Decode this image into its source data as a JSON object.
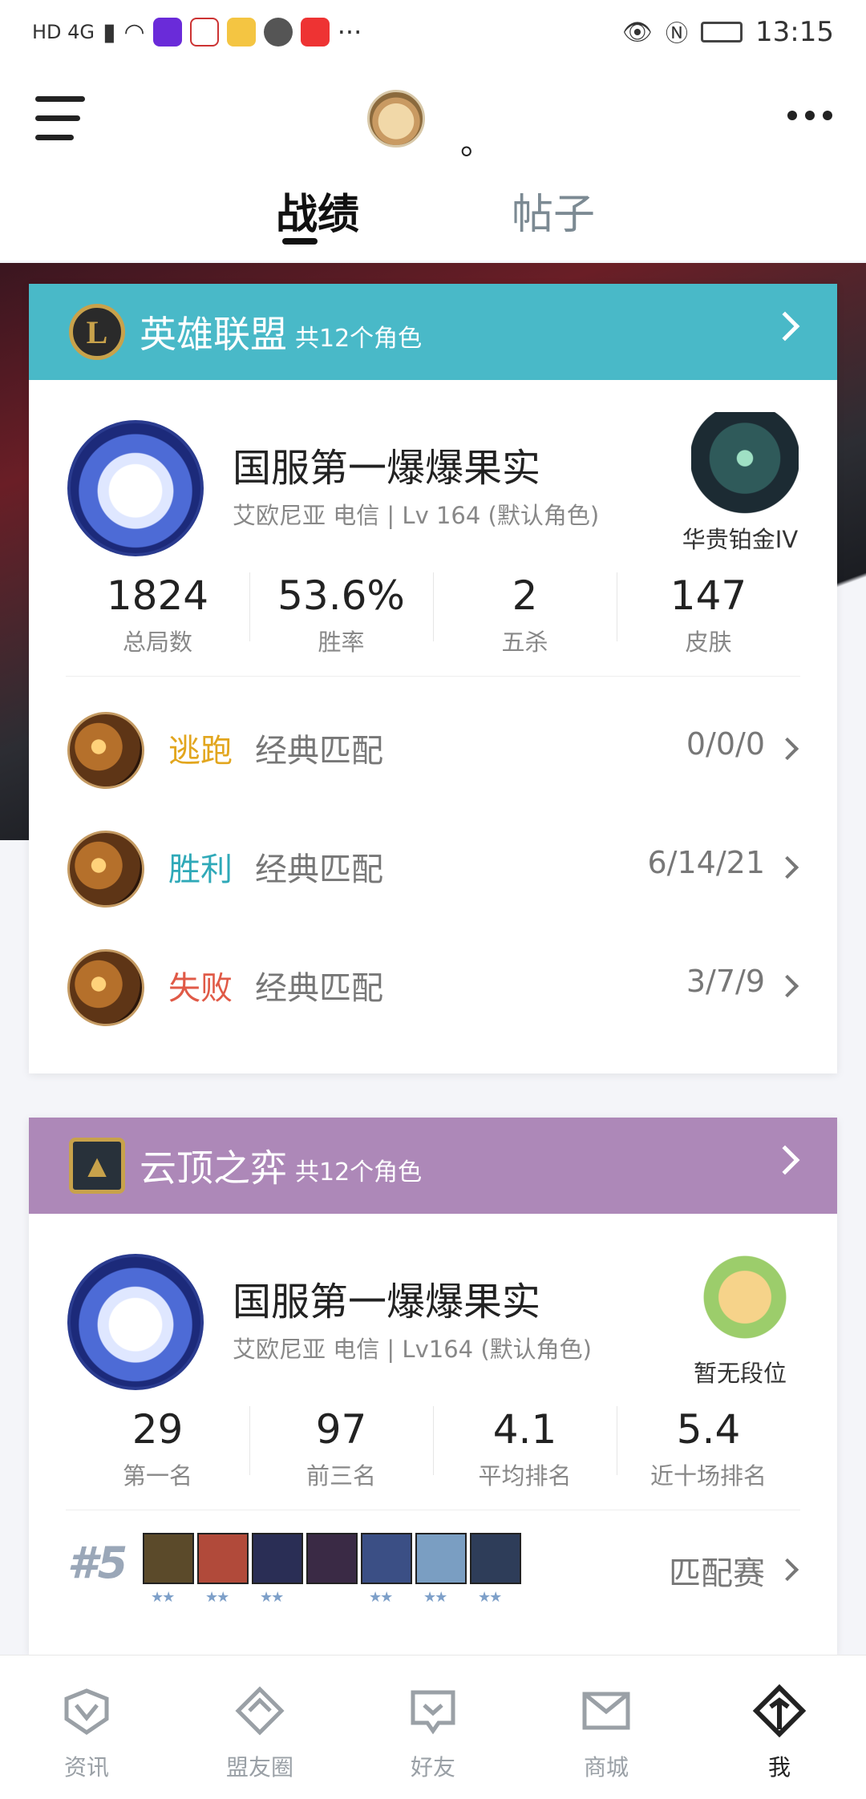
{
  "status_bar": {
    "left_text": "HD 4G",
    "app_icons": [
      "video-app-icon",
      "ticket-app-icon",
      "music-app-icon",
      "chat-icon",
      "gift-app-icon"
    ],
    "more": "···",
    "time": "13:15"
  },
  "topbar": {
    "nickname": "。"
  },
  "tabs": [
    {
      "label": "战绩",
      "active": true
    },
    {
      "label": "帖子",
      "active": false
    }
  ],
  "lol_card": {
    "game_name": "英雄联盟",
    "role_count": "共12个角色",
    "player_name": "国服第一爆爆果实",
    "server_info": "艾欧尼亚 电信 | Lv 164 (默认角色)",
    "rank": "华贵铂金IV",
    "stats": [
      {
        "value": "1824",
        "label": "总局数"
      },
      {
        "value": "53.6%",
        "label": "胜率"
      },
      {
        "value": "2",
        "label": "五杀"
      },
      {
        "value": "147",
        "label": "皮肤"
      }
    ],
    "matches": [
      {
        "result": "逃跑",
        "result_color": "#e2a61e",
        "mode": "经典匹配",
        "kda": "0/0/0"
      },
      {
        "result": "胜利",
        "result_color": "#2fa9b8",
        "mode": "经典匹配",
        "kda": "6/14/21"
      },
      {
        "result": "失败",
        "result_color": "#e05a47",
        "mode": "经典匹配",
        "kda": "3/7/9"
      }
    ]
  },
  "tft_card": {
    "game_name": "云顶之弈",
    "role_count": "共12个角色",
    "player_name": "国服第一爆爆果实",
    "server_info": "艾欧尼亚 电信 | Lv164 (默认角色)",
    "rank": "暂无段位",
    "stats": [
      {
        "value": "29",
        "label": "第一名"
      },
      {
        "value": "97",
        "label": "前三名"
      },
      {
        "value": "4.1",
        "label": "平均排名"
      },
      {
        "value": "5.4",
        "label": "近十场排名"
      }
    ],
    "recent": {
      "placement": "#5",
      "mode": "匹配赛",
      "champions": [
        {
          "color": "#5b4a2a",
          "stars": "★★"
        },
        {
          "color": "#b14a3a",
          "stars": "★★"
        },
        {
          "color": "#2a2e55",
          "stars": "★★"
        },
        {
          "color": "#3a2a45",
          "stars": ""
        },
        {
          "color": "#3b4f85",
          "stars": "★★"
        },
        {
          "color": "#7a9ec2",
          "stars": "★★"
        },
        {
          "color": "#2e3d59",
          "stars": "★★"
        }
      ]
    }
  },
  "bottom_nav": [
    {
      "label": "资讯",
      "active": false
    },
    {
      "label": "盟友圈",
      "active": false
    },
    {
      "label": "好友",
      "active": false
    },
    {
      "label": "商城",
      "active": false
    },
    {
      "label": "我",
      "active": true
    }
  ],
  "colors": {
    "lol_header": "#49b9c8",
    "tft_header": "#ad88b8",
    "background": "#f4f5f9"
  }
}
